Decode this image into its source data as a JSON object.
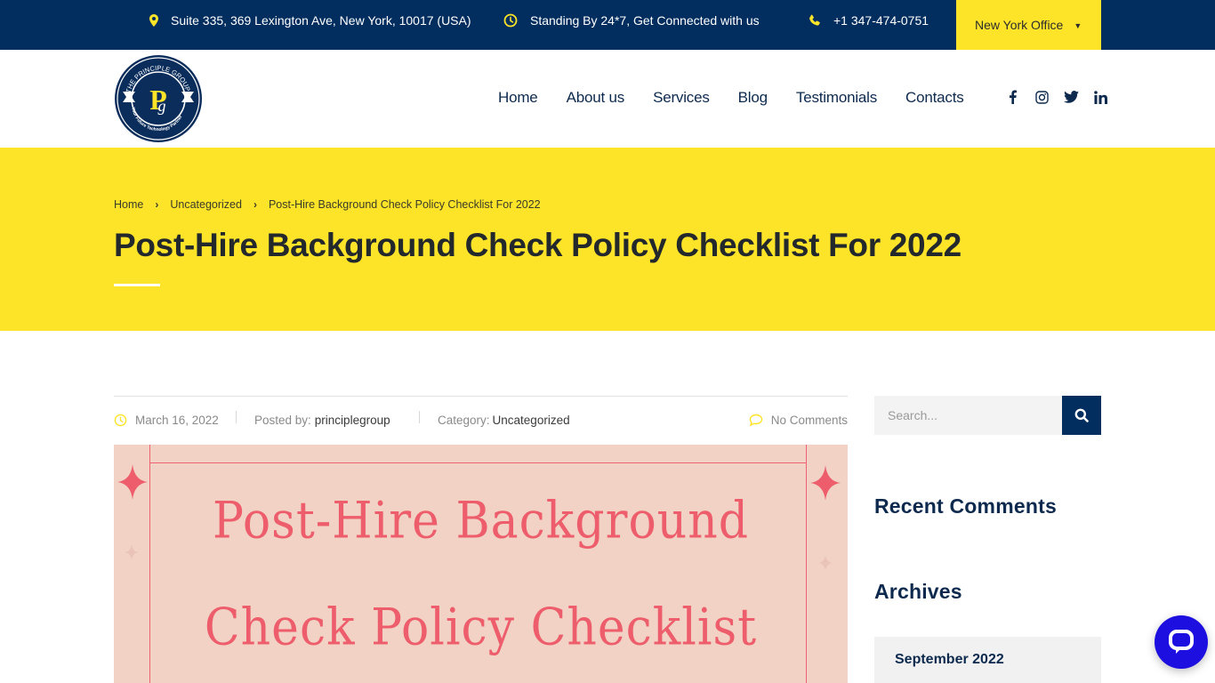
{
  "topbar": {
    "address": "Suite 335, 369 Lexington Ave, New York, 10017 (USA)",
    "availability": "Standing By 24*7, Get Connected with us",
    "phone": "+1 347-474-0751",
    "office_select": "New York Office",
    "icon_color": "#fde428",
    "background": "#022e5f"
  },
  "header": {
    "logo": {
      "name": "THE PRINCIPLE GROUP",
      "tagline": "Your Future Technology Partner",
      "monogram": "P"
    },
    "nav": [
      {
        "label": "Home"
      },
      {
        "label": "About us"
      },
      {
        "label": "Services"
      },
      {
        "label": "Blog"
      },
      {
        "label": "Testimonials"
      },
      {
        "label": "Contacts"
      }
    ],
    "socials": [
      "facebook-icon",
      "instagram-icon",
      "twitter-icon",
      "linkedin-icon"
    ]
  },
  "hero": {
    "breadcrumb": [
      "Home",
      "Uncategorized",
      "Post-Hire Background Check Policy Checklist For 2022"
    ],
    "title": "Post-Hire Background Check Policy Checklist For 2022",
    "background": "#fde428"
  },
  "post": {
    "date": "March 16, 2022",
    "posted_by_label": "Posted by:",
    "author": "principlegroup",
    "category_label": "Category:",
    "category": "Uncategorized",
    "comments": "No Comments",
    "featured_image": {
      "line1": "Post-Hire Background",
      "line2": "Check Policy Checklist",
      "text_color": "#ee5d6c",
      "background": "#f1d2c4"
    }
  },
  "sidebar": {
    "search_placeholder": "Search...",
    "recent_comments_title": "Recent Comments",
    "archives_title": "Archives",
    "archives": [
      "September 2022"
    ]
  },
  "chat": {
    "icon": "chat-bubble-icon",
    "color": "#1d0fe0"
  }
}
